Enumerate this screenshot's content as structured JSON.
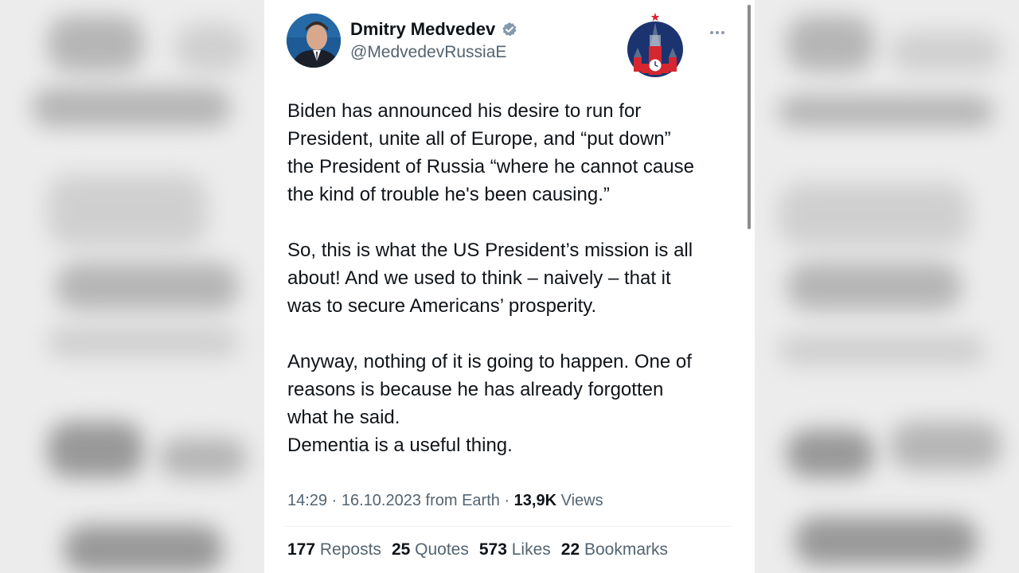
{
  "author": {
    "display_name": "Dmitry Medvedev",
    "handle": "@MedvedevRussiaE"
  },
  "tweet": {
    "paragraphs": [
      [
        "Biden has announced his desire to run for",
        "President, unite all of Europe, and “put down”",
        "the President of Russia “where he cannot cause",
        "the kind of trouble he's been causing.”"
      ],
      [
        "So, this is what the US President’s mission is all",
        "about! And we used to think – naively – that it",
        "was to secure Americans’ prosperity."
      ],
      [
        "Anyway, nothing of it is going to happen. One of",
        "reasons is because he has already forgotten",
        "what he said.",
        "Dementia is a useful thing."
      ]
    ]
  },
  "meta": {
    "time": "14:29",
    "date": "16.10.2023",
    "source": "from Earth",
    "views_count": "13,9K",
    "views_label": "Views"
  },
  "stats": [
    {
      "count": "177",
      "label": "Reposts"
    },
    {
      "count": "25",
      "label": "Quotes"
    },
    {
      "count": "573",
      "label": "Likes"
    },
    {
      "count": "22",
      "label": "Bookmarks"
    }
  ],
  "colors": {
    "text": "#0f1419",
    "secondary": "#536471",
    "verified_badge": "#829aab",
    "logo_bg": "#1b3470",
    "logo_red": "#d6262f"
  },
  "icons": {
    "verified": "verified-badge-icon",
    "more": "more-options-icon",
    "logo": "kremlin-logo"
  }
}
